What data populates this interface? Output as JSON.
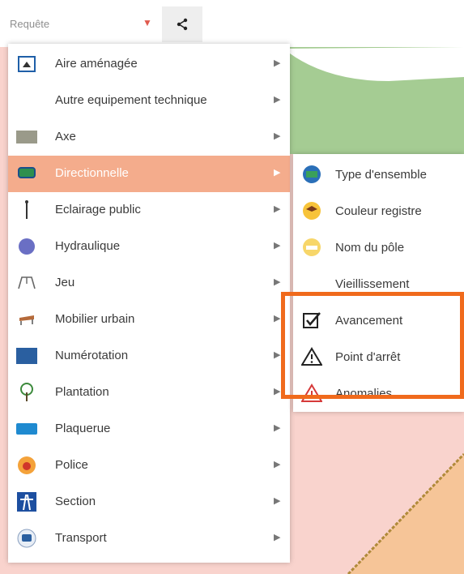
{
  "toolbar": {
    "select_label": "Requête",
    "caret_icon": "caret-down-icon",
    "share_icon": "share-icon"
  },
  "colors": {
    "menu_active_bg": "#f4ac8c",
    "highlight_border": "#f06a1c",
    "map_green": "#a5cc93",
    "map_pink": "#f9d3cd",
    "map_orange": "#f6c598"
  },
  "menu": {
    "items": [
      {
        "label": "Aire aménagée",
        "icon": "area-icon"
      },
      {
        "label": "Autre equipement technique",
        "icon": ""
      },
      {
        "label": "Axe",
        "icon": "axis-icon"
      },
      {
        "label": "Directionnelle",
        "icon": "sign-icon",
        "active": true
      },
      {
        "label": "Eclairage public",
        "icon": "street-light-icon"
      },
      {
        "label": "Hydraulique",
        "icon": "water-icon"
      },
      {
        "label": "Jeu",
        "icon": "playground-icon"
      },
      {
        "label": "Mobilier urbain",
        "icon": "bench-icon"
      },
      {
        "label": "Numérotation",
        "icon": "numbering-icon"
      },
      {
        "label": "Plantation",
        "icon": "tree-icon"
      },
      {
        "label": "Plaquerue",
        "icon": "street-plate-icon"
      },
      {
        "label": "Police",
        "icon": "police-icon"
      },
      {
        "label": "Section",
        "icon": "road-section-icon"
      },
      {
        "label": "Transport",
        "icon": "bus-icon"
      }
    ]
  },
  "submenu": {
    "items": [
      {
        "label": "Type d'ensemble",
        "icon": "sign-type-icon"
      },
      {
        "label": "Couleur registre",
        "icon": "color-register-icon"
      },
      {
        "label": "Nom du pôle",
        "icon": "pole-name-icon"
      },
      {
        "label": "Vieillissement",
        "icon": ""
      },
      {
        "label": "Avancement",
        "icon": "checkbox-checked-icon"
      },
      {
        "label": "Point d'arrêt",
        "icon": "warning-icon"
      },
      {
        "label": "Anomalies",
        "icon": "alert-red-icon"
      }
    ]
  }
}
